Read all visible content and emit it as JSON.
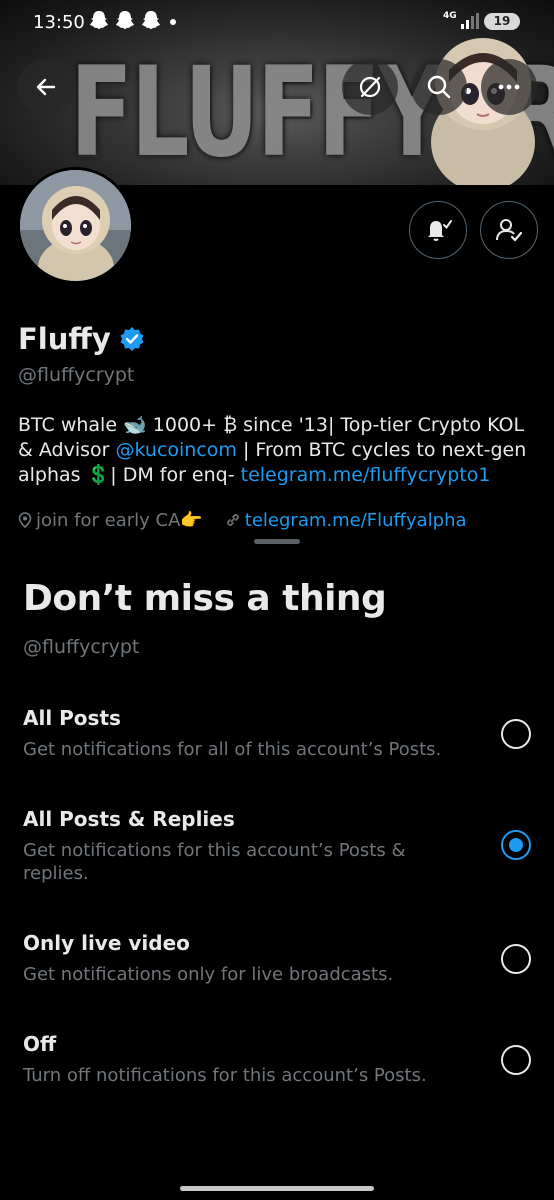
{
  "status_bar": {
    "time": "13:50",
    "network": "4G",
    "battery": "19"
  },
  "banner": {
    "text": "FLUFFYCRYPT"
  },
  "header_icons": {
    "back": "arrow-left-icon",
    "grok": "slash-circle-icon",
    "search": "search-icon",
    "more": "more-horizontal-icon"
  },
  "profile": {
    "name": "Fluffy",
    "handle": "@fluffycrypt",
    "verified_color": "#1d9bf0",
    "bio": {
      "part1": "BTC whale 🐋 1000+ ₿ since '13| Top-tier Crypto KOL & Advisor ",
      "mention": "@kucoincom",
      "part2": " | From BTC cycles to next-gen alphas 💲| DM for enq- ",
      "link": "telegram.me/fluffycrypto1"
    },
    "location": "join for early CA👉",
    "website": "telegram.me/Fluffyalpha"
  },
  "sheet": {
    "title": "Don’t miss a thing",
    "subtitle": "@fluffycrypt",
    "options": [
      {
        "title": "All Posts",
        "description": "Get notifications for all of this account’s Posts.",
        "selected": false
      },
      {
        "title": "All Posts & Replies",
        "description": "Get notifications for this account’s Posts & replies.",
        "selected": true
      },
      {
        "title": "Only live video",
        "description": "Get notifications only for live broadcasts.",
        "selected": false
      },
      {
        "title": "Off",
        "description": "Turn off notifications for this account’s Posts.",
        "selected": false
      }
    ]
  },
  "colors": {
    "accent": "#1d9bf0",
    "background": "#000000",
    "secondary_text": "#71767b"
  }
}
